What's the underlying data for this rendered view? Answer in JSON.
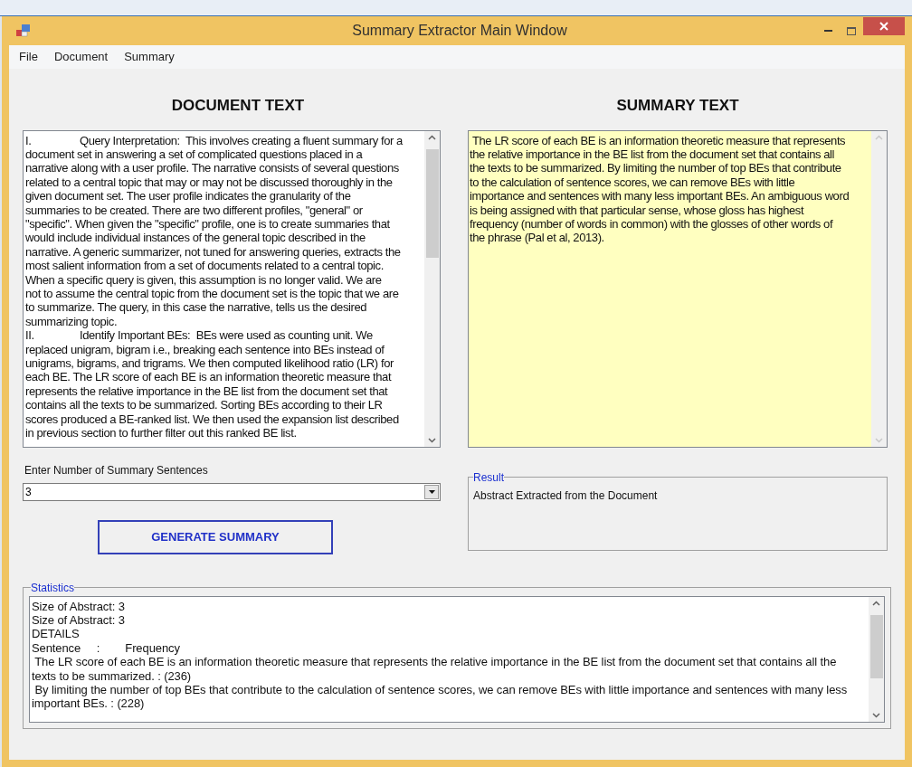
{
  "window": {
    "title": "Summary Extractor Main Window"
  },
  "menu": [
    "File",
    "Document",
    "Summary"
  ],
  "document": {
    "heading": "DOCUMENT TEXT",
    "text": "I.\tQuery Interpretation:  This involves creating a fluent summary for a\ndocument set in answering a set of complicated questions placed in a\nnarrative along with a user profile. The narrative consists of several questions\nrelated to a central topic that may or may not be discussed thoroughly in the\ngiven document set. The user profile indicates the granularity of the\nsummaries to be created. There are two different profiles, \"general\" or\n\"specific\". When given the \"specific\" profile, one is to create summaries that\nwould include individual instances of the general topic described in the\nnarrative. A generic summarizer, not tuned for answering queries, extracts the\nmost salient information from a set of documents related to a central topic.\nWhen a specific query is given, this assumption is no longer valid. We are\nnot to assume the central topic from the document set is the topic that we are\nto summarize. The query, in this case the narrative, tells us the desired\nsummarizing topic.\nII.\tIdentify Important BEs:  BEs were used as counting unit. We\nreplaced unigram, bigram i.e., breaking each sentence into BEs instead of\nunigrams, bigrams, and trigrams. We then computed likelihood ratio (LR) for\neach BE. The LR score of each BE is an information theoretic measure that\nrepresents the relative importance in the BE list from the document set that\ncontains all the texts to be summarized. Sorting BEs according to their LR\nscores produced a BE-ranked list. We then used the expansion list described\nin previous section to further filter out this ranked BE list."
  },
  "summary": {
    "heading": "SUMMARY TEXT",
    "text": " The LR score of each BE is an information theoretic measure that represents\nthe relative importance in the BE list from the document set that contains all\nthe texts to be summarized. By limiting the number of top BEs that contribute\nto the calculation of sentence scores, we can remove BEs with little\nimportance and sentences with many less important BEs. An ambiguous word\nis being assigned with that particular sense, whose gloss has highest\nfrequency (number of words in common) with the glosses of other words of\nthe phrase (Pal et al, 2013)."
  },
  "sentences_field": {
    "label": "Enter Number of Summary Sentences",
    "value": "3"
  },
  "generate_button": "GENERATE SUMMARY",
  "result": {
    "legend": "Result",
    "text": "Abstract Extracted from the Document"
  },
  "statistics": {
    "legend": "Statistics",
    "text": "Size of Abstract: 3\nSize of Abstract: 3\nDETAILS\nSentence     :        Frequency\n The LR score of each BE is an information theoretic measure that represents the relative importance in the BE list from the document set that contains all the\ntexts to be summarized. : (236)\n By limiting the number of top BEs that contribute to the calculation of sentence scores, we can remove BEs with little importance and sentences with many less\nimportant BEs. : (228)"
  }
}
